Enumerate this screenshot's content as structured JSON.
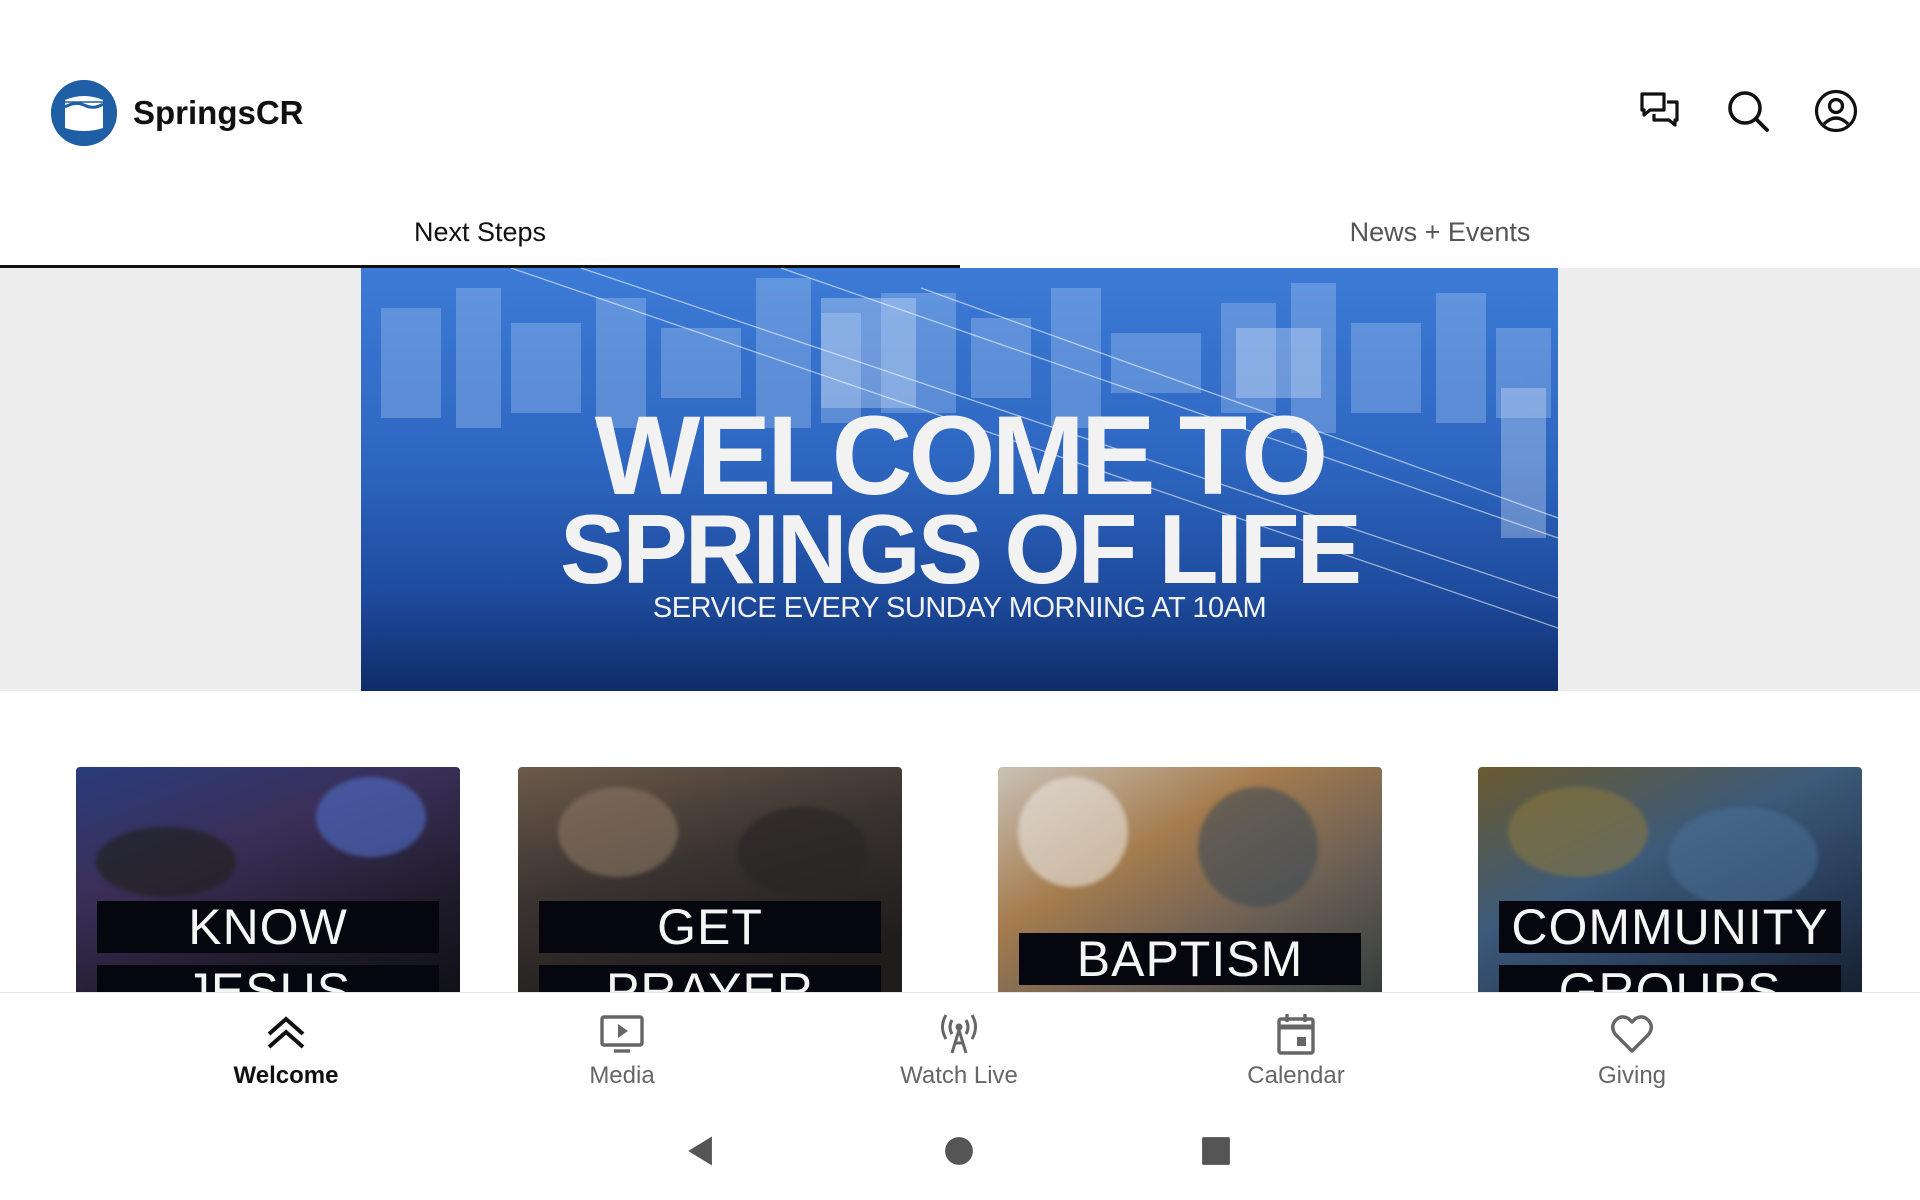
{
  "app": {
    "title": "SpringsCR",
    "logo_icon": "springs-logo-icon",
    "actions": [
      {
        "name": "chat-icon"
      },
      {
        "name": "search-icon"
      },
      {
        "name": "account-icon"
      }
    ]
  },
  "tabs": [
    {
      "label": "Next Steps",
      "active": true
    },
    {
      "label": "News + Events",
      "active": false
    }
  ],
  "hero": {
    "line1": "WELCOME TO",
    "line2": "SPRINGS OF LIFE",
    "subtitle": "SERVICE EVERY SUNDAY MORNING AT 10AM"
  },
  "cards": [
    {
      "line1": "KNOW",
      "line2": "JESUS"
    },
    {
      "line1": "GET",
      "line2": "PRAYER"
    },
    {
      "line1": "BAPTISM"
    },
    {
      "line1": "COMMUNITY",
      "line2": "GROUPS"
    }
  ],
  "bottom_nav": [
    {
      "label": "Welcome",
      "icon": "double-chevron-up-icon",
      "active": true
    },
    {
      "label": "Media",
      "icon": "tv-play-icon",
      "active": false
    },
    {
      "label": "Watch Live",
      "icon": "broadcast-antenna-icon",
      "active": false
    },
    {
      "label": "Calendar",
      "icon": "calendar-icon",
      "active": false
    },
    {
      "label": "Giving",
      "icon": "heart-icon",
      "active": false
    }
  ],
  "colors": {
    "brand": "#1f5fa6",
    "hero_blue": "#2e67c1",
    "active_text": "#111111",
    "inactive_text": "#666666"
  }
}
